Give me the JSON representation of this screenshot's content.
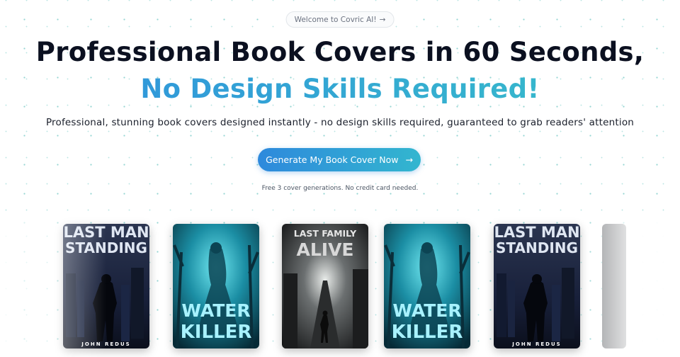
{
  "announcement": {
    "label": "Welcome to Covric AI!",
    "arrow": "→"
  },
  "hero": {
    "headline_line1": "Professional Book Covers in 60 Seconds,",
    "headline_line2": "No Design Skills Required!",
    "subheadline": "Professional, stunning book covers designed instantly - no design skills required, guaranteed to grab readers' attention"
  },
  "cta": {
    "label": "Generate My Book Cover Now",
    "arrow": "→"
  },
  "cta_note": "Free 3 cover generations. No credit card needed.",
  "colors": {
    "accent_start": "#2e89dc",
    "accent_end": "#33b6cf",
    "dot": "#3fb3b0"
  },
  "covers": [
    {
      "title_top": "LAST MAN",
      "title_bottom": "STANDING",
      "author": "JOHN REDUS",
      "theme": "city-night"
    },
    {
      "title_top": "WATER",
      "title_bottom": "KILLER",
      "author": "",
      "theme": "teal-forest"
    },
    {
      "title_top": "LAST FAMILY",
      "title_bottom": "ALIVE",
      "author": "",
      "theme": "dark-road"
    },
    {
      "title_top": "WATER",
      "title_bottom": "KILLER",
      "author": "",
      "theme": "teal-forest"
    },
    {
      "title_top": "LAST MAN",
      "title_bottom": "STANDING",
      "author": "JOHN REDUS",
      "theme": "city-night"
    }
  ]
}
